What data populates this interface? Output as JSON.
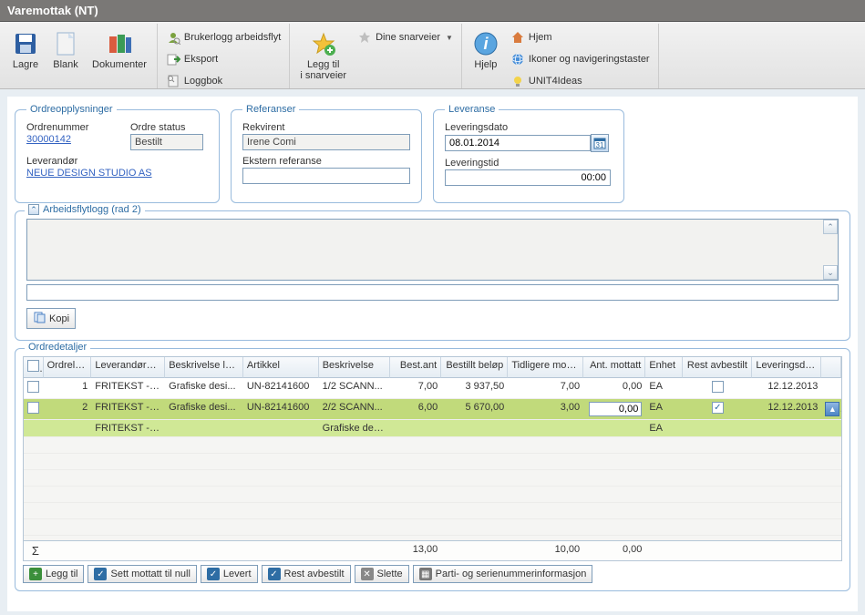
{
  "title": "Varemottak (NT)",
  "toolbar": {
    "lagre": "Lagre",
    "blank": "Blank",
    "dokumenter": "Dokumenter",
    "brukerlogg": "Brukerlogg arbeidsflyt",
    "eksport": "Eksport",
    "loggbok": "Loggbok",
    "leggtil_line1": "Legg til",
    "leggtil_line2": "i snarveier",
    "dine_snarveier": "Dine snarveier",
    "hjelp": "Hjelp",
    "hjem": "Hjem",
    "ikoner": "Ikoner og navigeringstaster",
    "unit4": "UNIT4Ideas"
  },
  "panels": {
    "ordreopplysninger": {
      "legend": "Ordreopplysninger",
      "ordrenummer_label": "Ordrenummer",
      "ordrenummer_value": "30000142",
      "ordre_status_label": "Ordre status",
      "ordre_status_value": "Bestilt",
      "leverandor_label": "Leverandør",
      "leverandor_value": "NEUE DESIGN STUDIO AS"
    },
    "referanser": {
      "legend": "Referanser",
      "rekvirent_label": "Rekvirent",
      "rekvirent_value": "Irene Comi",
      "ekstern_label": "Ekstern referanse",
      "ekstern_value": ""
    },
    "leveranse": {
      "legend": "Leveranse",
      "leveringsdato_label": "Leveringsdato",
      "leveringsdato_value": "08.01.2014",
      "leveringstid_label": "Leveringstid",
      "leveringstid_value": "00:00"
    }
  },
  "arbeidsflyt": {
    "legend": "Arbeidsflytlogg (rad 2)",
    "kopi": "Kopi",
    "input_value": ""
  },
  "ordredetaljer": {
    "legend": "Ordredetaljer",
    "columns": [
      "Ordrelinje",
      "Leverandørar...",
      "Beskrivelse le...",
      "Artikkel",
      "Beskrivelse",
      "Best.ant",
      "Bestillt beløp",
      "Tidligere mott...",
      "Ant. mottatt",
      "Enhet",
      "Rest avbestilt",
      "Leveringsdato"
    ],
    "rows": [
      {
        "selected": false,
        "linje": "1",
        "levart": "FRITEKST - N...",
        "beskrlev": "Grafiske desi...",
        "artikkel": "UN-82141600",
        "beskrivelse": "1/2 SCANN...",
        "bestant": "7,00",
        "bestbelop": "3 937,50",
        "tidligere": "7,00",
        "mottatt": "0,00",
        "enhet": "EA",
        "rest_checked": false,
        "levdato": "12.12.2013",
        "expand": false
      },
      {
        "selected": true,
        "linje": "2",
        "levart": "FRITEKST - N...",
        "beskrlev": "Grafiske desi...",
        "artikkel": "UN-82141600",
        "beskrivelse": "2/2 SCANN...",
        "bestant": "6,00",
        "bestbelop": "5 670,00",
        "tidligere": "3,00",
        "mottatt": "0,00",
        "enhet": "EA",
        "rest_checked": true,
        "levdato": "12.12.2013",
        "expand": true,
        "subrow": {
          "levart": "FRITEKST - NE...",
          "beskrivelse": "Grafiske desig...",
          "enhet": "EA"
        }
      }
    ],
    "sums": {
      "bestant": "13,00",
      "tidligere": "10,00",
      "mottatt": "0,00"
    }
  },
  "buttons": {
    "leggtil": "Legg til",
    "sett_null": "Sett mottatt til null",
    "levert": "Levert",
    "rest_avbestilt": "Rest avbestilt",
    "slette": "Slette",
    "parti": "Parti- og serienummerinformasjon"
  }
}
